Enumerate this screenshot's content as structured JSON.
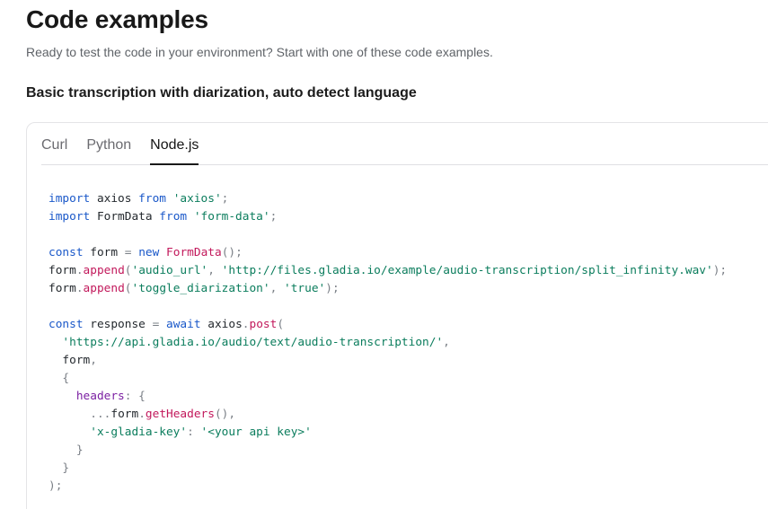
{
  "header": {
    "title": "Code examples",
    "subtitle": "Ready to test the code in your environment? Start with one of these code examples."
  },
  "section": {
    "heading": "Basic transcription with diarization, auto detect language"
  },
  "tabs": [
    {
      "label": "Curl",
      "active": false
    },
    {
      "label": "Python",
      "active": false
    },
    {
      "label": "Node.js",
      "active": true
    }
  ],
  "code": {
    "language": "javascript",
    "lines": [
      [
        [
          "kw",
          "import"
        ],
        [
          "id",
          " axios "
        ],
        [
          "kw",
          "from"
        ],
        [
          "id",
          " "
        ],
        [
          "str",
          "'axios'"
        ],
        [
          "punc",
          ";"
        ]
      ],
      [
        [
          "kw",
          "import"
        ],
        [
          "id",
          " FormData "
        ],
        [
          "kw",
          "from"
        ],
        [
          "id",
          " "
        ],
        [
          "str",
          "'form-data'"
        ],
        [
          "punc",
          ";"
        ]
      ],
      [],
      [
        [
          "kw",
          "const"
        ],
        [
          "id",
          " form "
        ],
        [
          "op",
          "="
        ],
        [
          "id",
          " "
        ],
        [
          "kw",
          "new"
        ],
        [
          "id",
          " "
        ],
        [
          "fn",
          "FormData"
        ],
        [
          "punc",
          "();"
        ]
      ],
      [
        [
          "id",
          "form"
        ],
        [
          "punc",
          "."
        ],
        [
          "fn",
          "append"
        ],
        [
          "punc",
          "("
        ],
        [
          "str",
          "'audio_url'"
        ],
        [
          "punc",
          ", "
        ],
        [
          "str",
          "'http://files.gladia.io/example/audio-transcription/split_infinity.wav'"
        ],
        [
          "punc",
          ");"
        ]
      ],
      [
        [
          "id",
          "form"
        ],
        [
          "punc",
          "."
        ],
        [
          "fn",
          "append"
        ],
        [
          "punc",
          "("
        ],
        [
          "str",
          "'toggle_diarization'"
        ],
        [
          "punc",
          ", "
        ],
        [
          "str",
          "'true'"
        ],
        [
          "punc",
          ");"
        ]
      ],
      [],
      [
        [
          "kw",
          "const"
        ],
        [
          "id",
          " response "
        ],
        [
          "op",
          "="
        ],
        [
          "id",
          " "
        ],
        [
          "kw",
          "await"
        ],
        [
          "id",
          " axios"
        ],
        [
          "punc",
          "."
        ],
        [
          "fn",
          "post"
        ],
        [
          "punc",
          "("
        ]
      ],
      [
        [
          "id",
          "  "
        ],
        [
          "str",
          "'https://api.gladia.io/audio/text/audio-transcription/'"
        ],
        [
          "punc",
          ","
        ]
      ],
      [
        [
          "id",
          "  form"
        ],
        [
          "punc",
          ","
        ]
      ],
      [
        [
          "id",
          "  "
        ],
        [
          "punc",
          "{"
        ]
      ],
      [
        [
          "id",
          "    "
        ],
        [
          "prop",
          "headers"
        ],
        [
          "punc",
          ": {"
        ]
      ],
      [
        [
          "id",
          "      "
        ],
        [
          "punc",
          "..."
        ],
        [
          "id",
          "form"
        ],
        [
          "punc",
          "."
        ],
        [
          "fn",
          "getHeaders"
        ],
        [
          "punc",
          "(),"
        ]
      ],
      [
        [
          "id",
          "      "
        ],
        [
          "str",
          "'x-gladia-key'"
        ],
        [
          "punc",
          ": "
        ],
        [
          "str",
          "'<your api key>'"
        ]
      ],
      [
        [
          "id",
          "    "
        ],
        [
          "punc",
          "}"
        ]
      ],
      [
        [
          "id",
          "  "
        ],
        [
          "punc",
          "}"
        ]
      ],
      [
        [
          "punc",
          ");"
        ]
      ]
    ]
  }
}
